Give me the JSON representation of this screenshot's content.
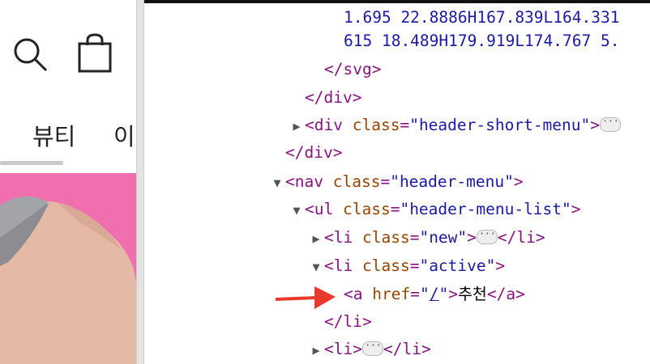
{
  "page": {
    "nav": {
      "beauty_label": "뷰티",
      "more_label": "이"
    }
  },
  "devtools": {
    "lines": [
      {
        "text": "1.695 22.8886H167.839L164.331"
      },
      {
        "text": "615 18.489H179.919L174.767 5."
      },
      {
        "close_tag": "svg"
      },
      {
        "close_tag": "div"
      },
      {
        "tag": "div",
        "attr": "class",
        "value": "header-short-menu"
      },
      {
        "close_tag": "div"
      },
      {
        "tag": "nav",
        "attr": "class",
        "value": "header-menu"
      },
      {
        "tag": "ul",
        "attr": "class",
        "value": "header-menu-list"
      },
      {
        "tag": "li",
        "attr": "class",
        "value": "new"
      },
      {
        "tag": "li",
        "attr": "class",
        "value": "active"
      },
      {
        "tag": "a",
        "attr": "href",
        "value": "/",
        "text": "추천"
      },
      {
        "close_tag": "li"
      },
      {
        "tag": "li"
      }
    ]
  },
  "colors": {
    "tag": "#881280",
    "attr": "#994500",
    "value": "#1a1aa6",
    "arrow": "#e8392b",
    "hero_bg": "#f06fae"
  }
}
